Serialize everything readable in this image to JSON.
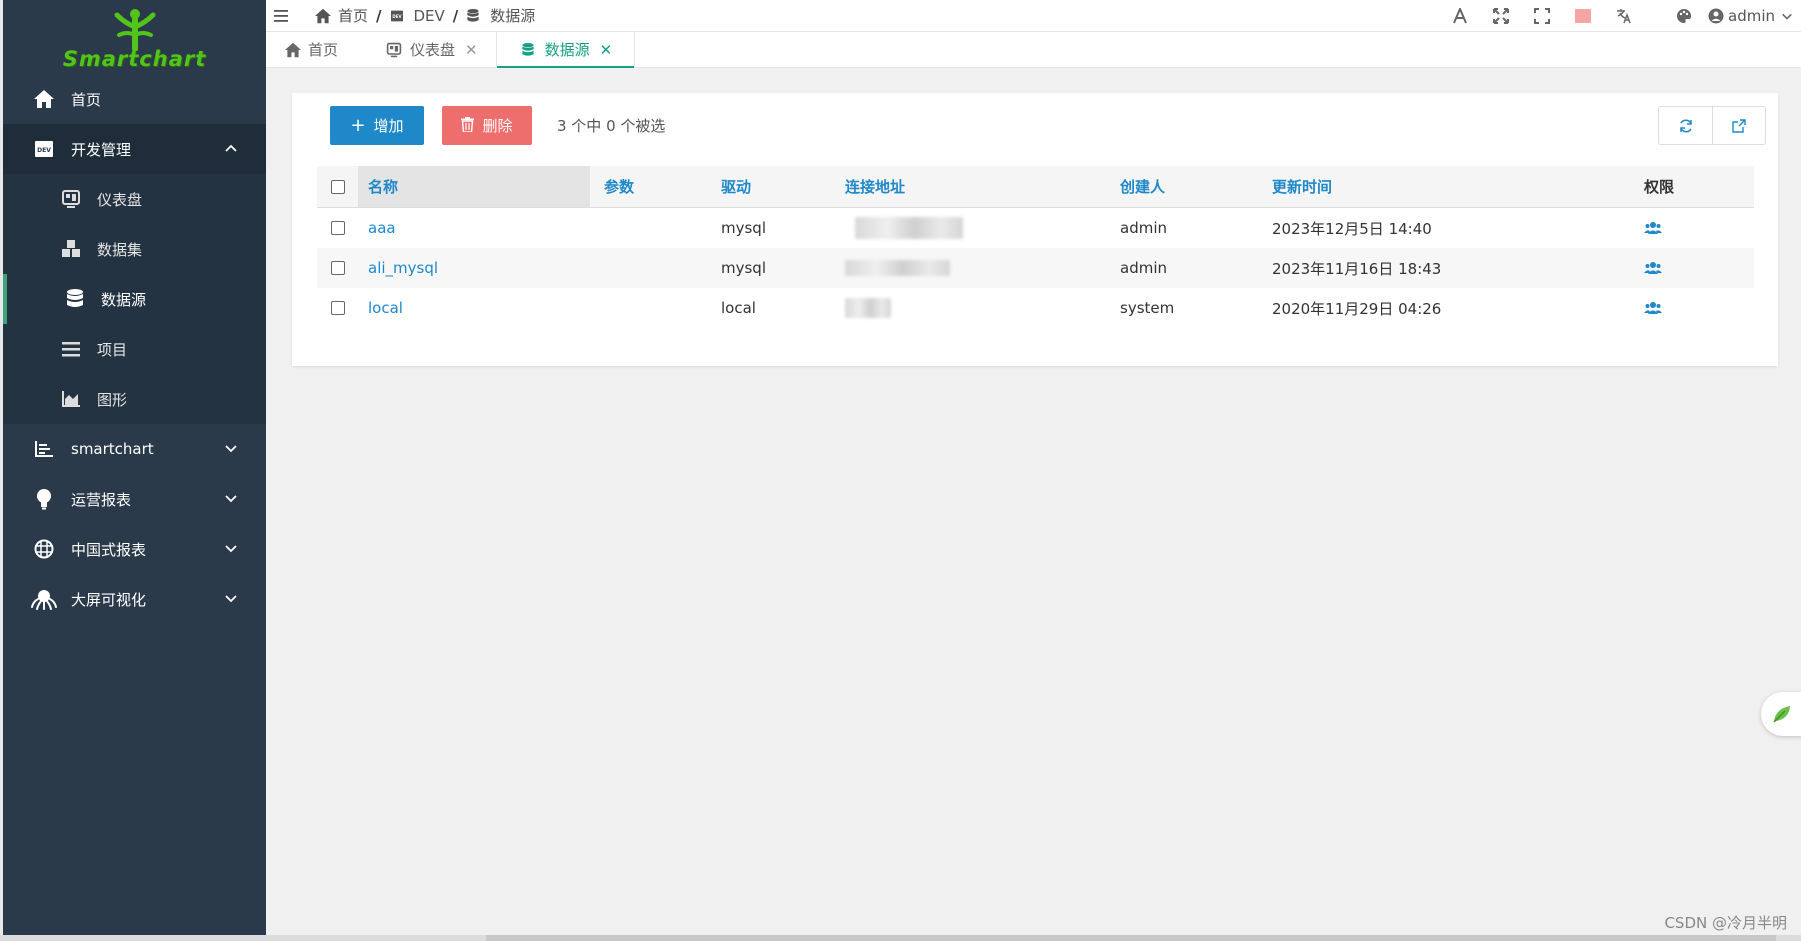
{
  "app": {
    "logo_text": "Smartchart"
  },
  "sidebar": {
    "items": [
      {
        "label": "首页",
        "icon": "home-icon"
      },
      {
        "label": "开发管理",
        "icon": "dev-icon",
        "expanded": true,
        "children": [
          {
            "label": "仪表盘",
            "icon": "dashboard-icon"
          },
          {
            "label": "数据集",
            "icon": "cubes-icon"
          },
          {
            "label": "数据源",
            "icon": "database-icon",
            "active": true
          },
          {
            "label": "项目",
            "icon": "list-icon"
          },
          {
            "label": "图形",
            "icon": "area-chart-icon"
          }
        ]
      },
      {
        "label": "smartchart",
        "icon": "bar-chart-icon"
      },
      {
        "label": "运营报表",
        "icon": "lightbulb-icon"
      },
      {
        "label": "中国式报表",
        "icon": "grid-ball-icon"
      },
      {
        "label": "大屏可视化",
        "icon": "octopus-icon"
      }
    ]
  },
  "header": {
    "breadcrumb": [
      "首页",
      "DEV",
      "数据源"
    ],
    "separator": "/",
    "tools": [
      "font-icon",
      "expand-icon",
      "fullscreen-icon",
      "dev-badge-icon",
      "translate-icon",
      "palette-icon"
    ],
    "user": "admin"
  },
  "tabs": [
    {
      "label": "首页",
      "icon": "home-icon",
      "closable": false
    },
    {
      "label": "仪表盘",
      "icon": "dashboard-icon",
      "closable": true
    },
    {
      "label": "数据源",
      "icon": "database-icon",
      "closable": true,
      "active": true
    }
  ],
  "toolbar": {
    "add_label": "增加",
    "delete_label": "删除",
    "selection_info": "3 个中 0 个被选"
  },
  "table": {
    "columns": [
      "名称",
      "参数",
      "驱动",
      "连接地址",
      "创建人",
      "更新时间",
      "权限"
    ],
    "rows": [
      {
        "name": "aaa",
        "param": "",
        "driver": "mysql",
        "creator": "admin",
        "updated": "2023年12月5日 14:40"
      },
      {
        "name": "ali_mysql",
        "param": "",
        "driver": "mysql",
        "creator": "admin",
        "updated": "2023年11月16日 18:43"
      },
      {
        "name": "local",
        "param": "",
        "driver": "local",
        "creator": "system",
        "updated": "2020年11月29日 04:26"
      }
    ]
  },
  "watermark": "CSDN @冷月半明",
  "colors": {
    "sidebar_bg": "#2b3a4a",
    "accent": "#16a085",
    "primary": "#1e88c9",
    "danger": "#ee6e6e",
    "logo_green": "#52c41a"
  }
}
